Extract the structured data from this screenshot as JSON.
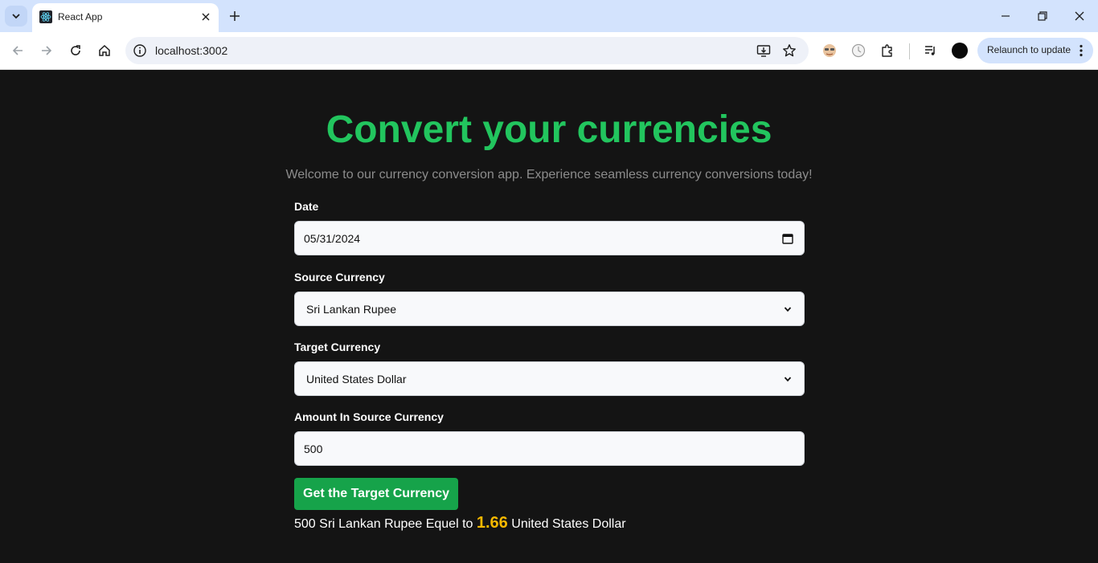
{
  "browser": {
    "tab_title": "React App",
    "url": "localhost:3002",
    "relaunch_label": "Relaunch to update",
    "icons": {
      "tab_search": "chevron-down-icon",
      "favicon": "react-icon",
      "tab_close": "close-icon",
      "new_tab": "plus-icon",
      "minimize": "minimize-icon",
      "restore": "restore-icon",
      "close": "close-icon",
      "back": "back-arrow-icon",
      "forward": "forward-arrow-icon",
      "reload": "reload-icon",
      "home": "home-icon",
      "site_info": "info-icon",
      "install": "install-app-icon",
      "bookmark": "star-icon",
      "extensions": "puzzle-icon",
      "media": "media-controls-icon",
      "menu": "kebab-menu-icon"
    }
  },
  "app": {
    "title": "Convert your currencies",
    "subtitle": "Welcome to our currency conversion app. Experience seamless currency conversions today!",
    "date": {
      "label": "Date",
      "value": "05/31/2024"
    },
    "source": {
      "label": "Source Currency",
      "value": "Sri Lankan Rupee"
    },
    "target": {
      "label": "Target Currency",
      "value": "United States Dollar"
    },
    "amount": {
      "label": "Amount In Source Currency",
      "value": "500"
    },
    "button_label": "Get the Target Currency",
    "result": {
      "amount": "500",
      "source_currency": "Sri Lankan Rupee",
      "connector": "Equel to",
      "value": "1.66",
      "target_currency": "United States Dollar"
    }
  },
  "colors": {
    "page_bg": "#141414",
    "title": "#22c55e",
    "button": "#16a34a",
    "result_value": "#f5b800"
  }
}
